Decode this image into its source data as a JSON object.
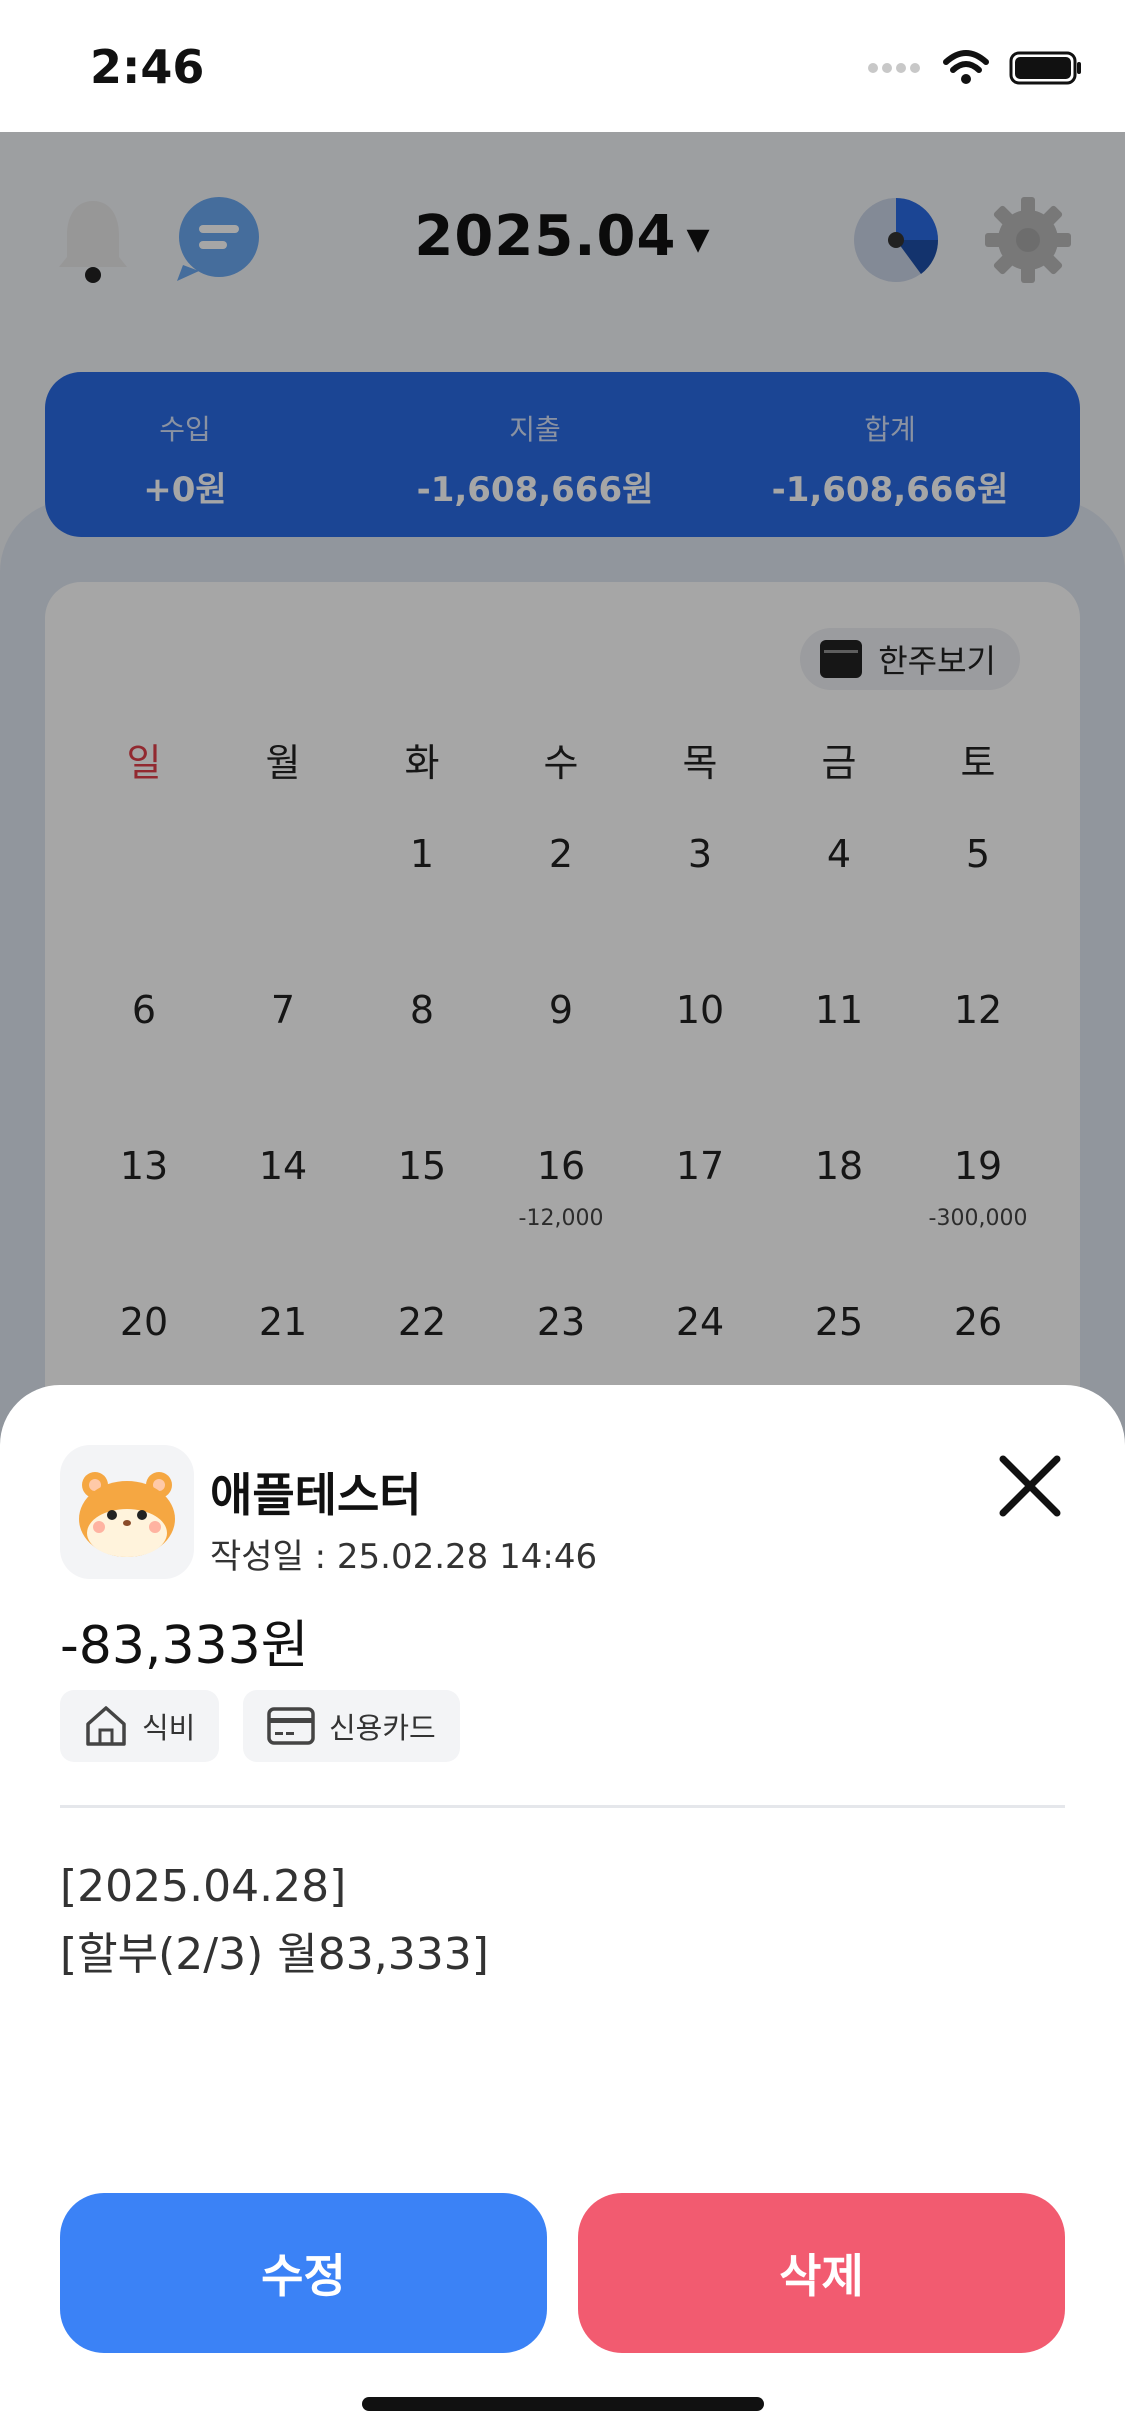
{
  "status_bar": {
    "time": "2:46"
  },
  "header": {
    "month": "2025.04"
  },
  "summary": {
    "income_label": "수입",
    "income_value": "+0원",
    "expense_label": "지출",
    "expense_value": "-1,608,666원",
    "total_label": "합계",
    "total_value": "-1,608,666원"
  },
  "calendar": {
    "week_toggle_label": "한주보기",
    "weekdays": [
      "일",
      "월",
      "화",
      "수",
      "목",
      "금",
      "토"
    ],
    "rows": [
      [
        "",
        "",
        "1",
        "2",
        "3",
        "4",
        "5"
      ],
      [
        "6",
        "7",
        "8",
        "9",
        "10",
        "11",
        "12"
      ],
      [
        "13",
        "14",
        "15",
        "16",
        "17",
        "18",
        "19"
      ],
      [
        "20",
        "21",
        "22",
        "23",
        "24",
        "25",
        "26"
      ]
    ],
    "amounts": {
      "wed_16": "-12,000",
      "sat_19": "-300,000"
    }
  },
  "sheet": {
    "title": "애플테스터",
    "date_line": "작성일 : 25.02.28 14:46",
    "amount": "-83,333원",
    "category_label": "식비",
    "payment_label": "신용카드",
    "memo_line1": "[2025.04.28]",
    "memo_line2": "[할부(2/3) 월83,333]",
    "edit_label": "수정",
    "delete_label": "삭제"
  },
  "colors": {
    "primary": "#3b82f6",
    "danger": "#f25b70",
    "summary_bg": "#2a6ae3",
    "sunday": "#e0404a"
  }
}
